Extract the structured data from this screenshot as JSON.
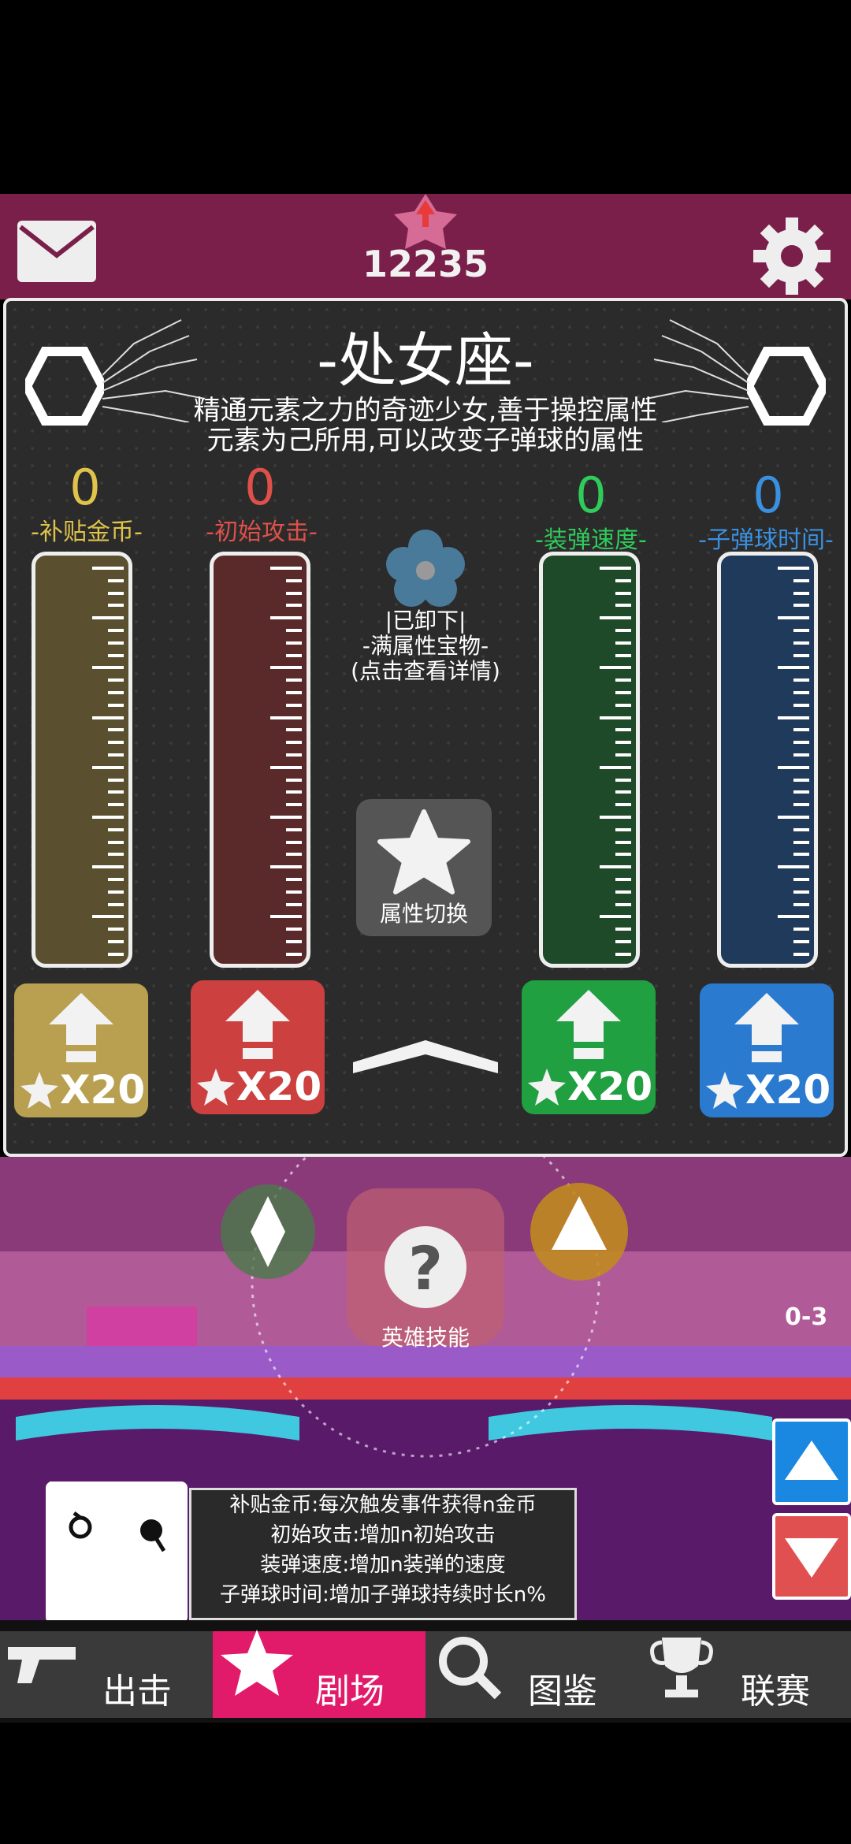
{
  "header": {
    "score": "12235",
    "icons": {
      "mail": "mail-icon",
      "settings": "gear-icon",
      "rank": "star-up-icon"
    }
  },
  "hero": {
    "title": "-处女座-",
    "description": "精通元素之力的奇迹少女,善于操控属性元素为己所用,可以改变子弹球的属性"
  },
  "stats": [
    {
      "value": "0",
      "label": "-补贴金币-",
      "color": "#e0c34a",
      "upgrade_cost": "X20",
      "fill": 0
    },
    {
      "value": "0",
      "label": "-初始攻击-",
      "color": "#e0504a",
      "upgrade_cost": "X20",
      "fill": 0
    },
    {
      "value": "0",
      "label": "-装弹速度-",
      "color": "#2ecc5a",
      "upgrade_cost": "X20",
      "fill": 0
    },
    {
      "value": "0",
      "label": "-子弹球时间-",
      "color": "#3a90e0",
      "upgrade_cost": "X20",
      "fill": 0
    }
  ],
  "treasure": {
    "status": "|已卸下|",
    "name": "-满属性宝物-",
    "hint": "(点击查看详情)"
  },
  "switch": {
    "label": "属性切换"
  },
  "scene": {
    "skill_label": "英雄技能",
    "counter": "0-3"
  },
  "info": {
    "lines": [
      "补贴金币:每次触发事件获得n金币",
      "初始攻击:增加n初始攻击",
      "装弹速度:增加n装弹的速度",
      "子弹球时间:增加子弹球持续时长n%"
    ]
  },
  "nav": {
    "tabs": [
      {
        "label": "出击",
        "icon": "gun-icon"
      },
      {
        "label": "剧场",
        "icon": "star-icon",
        "active": true
      },
      {
        "label": "图鉴",
        "icon": "magnifier-icon"
      },
      {
        "label": "联赛",
        "icon": "trophy-icon"
      }
    ]
  }
}
